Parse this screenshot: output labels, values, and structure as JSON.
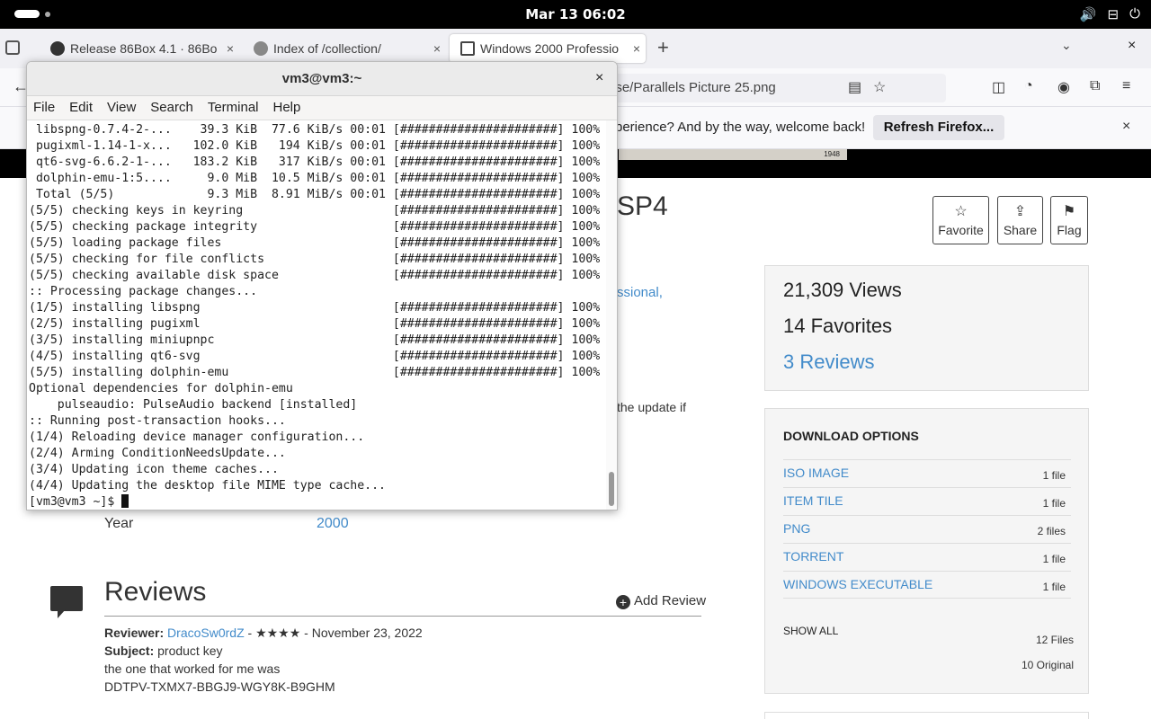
{
  "topbar": {
    "clock": "Mar 13  06:02",
    "tray_icons": [
      "volume-icon",
      "network-icon",
      "power-icon"
    ],
    "tray_glyphs": [
      "🔊",
      "⊟",
      "⏻"
    ]
  },
  "browser": {
    "tabs": [
      {
        "label": "Release 86Box 4.1 · 86Bo",
        "close": "×"
      },
      {
        "label": "Index of /collection/",
        "close": "×"
      },
      {
        "label": "Windows 2000 Professio",
        "close": "×"
      }
    ],
    "new_tab": "+",
    "tab_dropdown": "⌄",
    "window_close": "×",
    "url_fragment": "ese/Parallels Picture 25.png",
    "notification": {
      "message": "perience? And by the way, welcome back!",
      "button": "Refresh Firefox...",
      "close": "×"
    }
  },
  "page": {
    "thumb_strip_text": "1948",
    "title_fragment": "SP4",
    "actions": [
      {
        "label": "Favorite",
        "glyph": "☆"
      },
      {
        "label": "Share",
        "glyph": "⇪"
      },
      {
        "label": "Flag",
        "glyph": "⚑"
      }
    ],
    "stats": {
      "views": "21,309 Views",
      "favorites": "14 Favorites",
      "reviews": "3 Reviews"
    },
    "link_fragment": "ssional,",
    "text_fragment": "the update if",
    "year_label": "Year",
    "year_value": "2000",
    "downloads": {
      "header": "DOWNLOAD OPTIONS",
      "rows": [
        {
          "format": "ISO IMAGE",
          "count": "1 file"
        },
        {
          "format": "ITEM TILE",
          "count": "1 file"
        },
        {
          "format": "PNG",
          "count": "2 files"
        },
        {
          "format": "TORRENT",
          "count": "1 file"
        },
        {
          "format": "WINDOWS EXECUTABLE",
          "count": "1 file"
        }
      ],
      "show_all": "SHOW ALL",
      "total_files": "12 Files",
      "original_files": "10 Original"
    },
    "reviews": {
      "title": "Reviews",
      "add_review": "Add Review",
      "reviewer_label": "Reviewer:",
      "reviewer_name": "DracoSw0rdZ",
      "reviewer_meta": " - ★★★★ - November 23, 2022",
      "subject_label": "Subject:",
      "subject": "product key",
      "body_line1": "the one that worked for me was",
      "body_line2": "DDTPV-TXMX7-BBGJ9-WGY8K-B9GHM"
    }
  },
  "terminal": {
    "title": "vm3@vm3:~",
    "close": "×",
    "menu": [
      "File",
      "Edit",
      "View",
      "Search",
      "Terminal",
      "Help"
    ],
    "lines": [
      " libspng-0.7.4-2-...    39.3 KiB  77.6 KiB/s 00:01 [######################] 100%",
      " pugixml-1.14-1-x...   102.0 KiB   194 KiB/s 00:01 [######################] 100%",
      " qt6-svg-6.6.2-1-...   183.2 KiB   317 KiB/s 00:01 [######################] 100%",
      " dolphin-emu-1:5....     9.0 MiB  10.5 MiB/s 00:01 [######################] 100%",
      " Total (5/5)             9.3 MiB  8.91 MiB/s 00:01 [######################] 100%",
      "(5/5) checking keys in keyring                     [######################] 100%",
      "(5/5) checking package integrity                   [######################] 100%",
      "(5/5) loading package files                        [######################] 100%",
      "(5/5) checking for file conflicts                  [######################] 100%",
      "(5/5) checking available disk space                [######################] 100%",
      ":: Processing package changes...",
      "(1/5) installing libspng                           [######################] 100%",
      "(2/5) installing pugixml                           [######################] 100%",
      "(3/5) installing miniupnpc                         [######################] 100%",
      "(4/5) installing qt6-svg                           [######################] 100%",
      "(5/5) installing dolphin-emu                       [######################] 100%",
      "Optional dependencies for dolphin-emu",
      "    pulseaudio: PulseAudio backend [installed]",
      ":: Running post-transaction hooks...",
      "(1/4) Reloading device manager configuration...",
      "(2/4) Arming ConditionNeedsUpdate...",
      "(3/4) Updating icon theme caches...",
      "(4/4) Updating the desktop file MIME type cache..."
    ],
    "prompt": "[vm3@vm3 ~]$ "
  }
}
